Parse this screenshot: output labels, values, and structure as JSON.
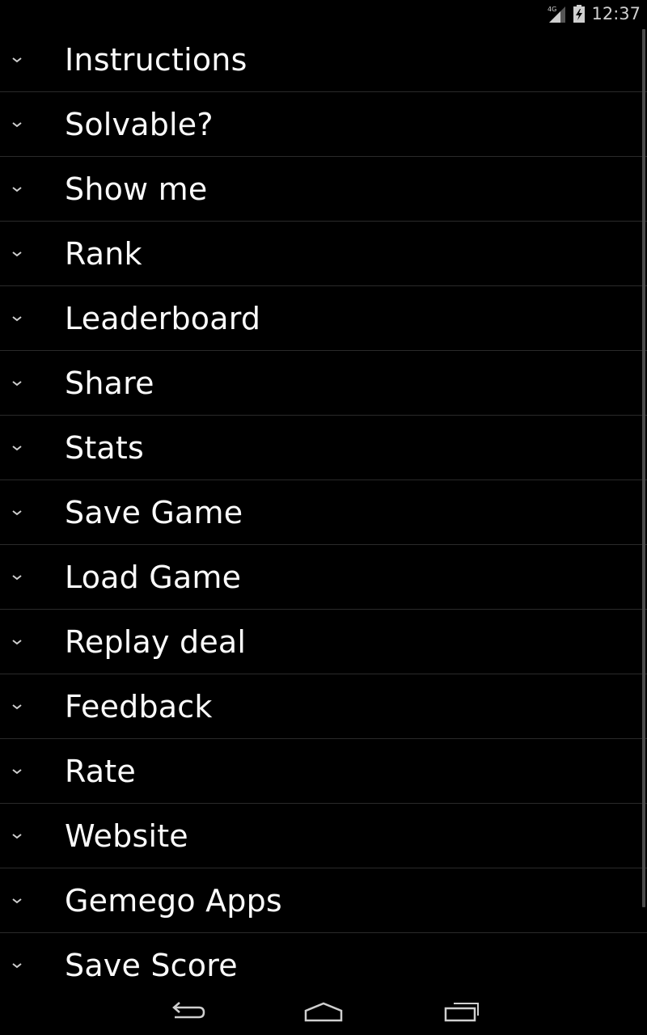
{
  "status_bar": {
    "network_label": "4G",
    "time": "12:37",
    "icons": [
      "signal-4g-icon",
      "battery-charging-icon"
    ]
  },
  "menu": {
    "items": [
      {
        "label": "Instructions"
      },
      {
        "label": "Solvable?"
      },
      {
        "label": "Show me"
      },
      {
        "label": "Rank"
      },
      {
        "label": "Leaderboard"
      },
      {
        "label": "Share"
      },
      {
        "label": "Stats"
      },
      {
        "label": "Save Game"
      },
      {
        "label": "Load Game"
      },
      {
        "label": "Replay deal"
      },
      {
        "label": "Feedback"
      },
      {
        "label": "Rate"
      },
      {
        "label": "Website"
      },
      {
        "label": "Gemego Apps"
      },
      {
        "label": "Save Score"
      }
    ]
  },
  "nav_bar": {
    "buttons": [
      "back-icon",
      "home-icon",
      "recent-apps-icon"
    ]
  },
  "colors": {
    "background": "#000000",
    "text": "#fafafa",
    "divider": "#2a2a2a",
    "icon": "#cfcfcf"
  }
}
